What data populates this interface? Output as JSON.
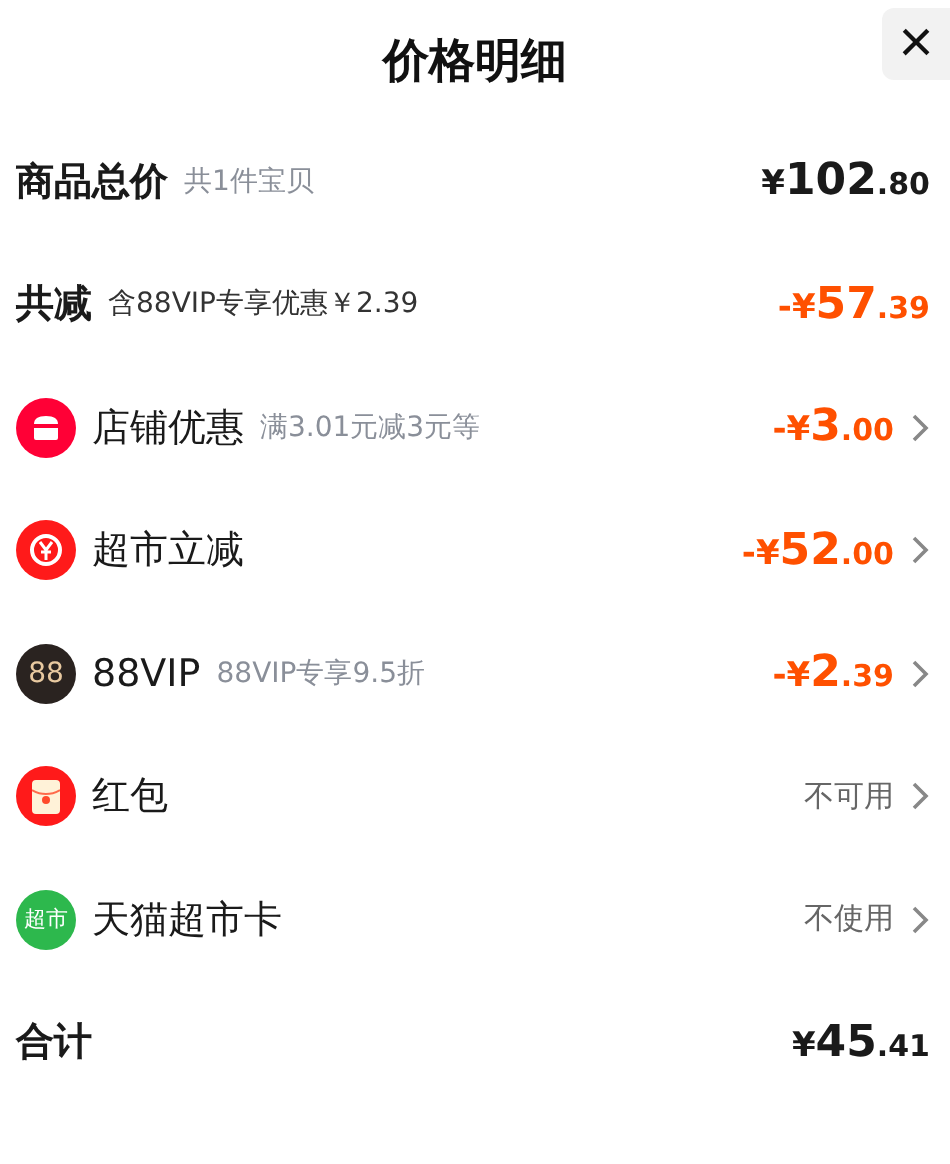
{
  "header": {
    "title": "价格明细",
    "close_label": "×"
  },
  "rows": [
    {
      "kind": "summary",
      "label": "商品总价",
      "note": "共1件宝贝",
      "amount": {
        "color": "#1a1a1a",
        "prefix": "¥",
        "integer": "102",
        "decimal": ".80"
      }
    },
    {
      "kind": "summary",
      "label": "共减",
      "note": "含88VIP专享优惠￥2.39",
      "amount": {
        "color": "#ff5000",
        "prefix": "-¥",
        "integer": "57",
        "decimal": ".39"
      }
    },
    {
      "kind": "item",
      "label": "店铺优惠",
      "note": "满3.01元减3元等",
      "amount": {
        "color": "#ff5000",
        "prefix": "-¥",
        "integer": "3",
        "decimal": ".00"
      }
    },
    {
      "kind": "item",
      "label": "超市立减",
      "amount": {
        "color": "#ff5000",
        "prefix": "-¥",
        "integer": "52",
        "decimal": ".00"
      }
    },
    {
      "kind": "item",
      "icon_text": "88",
      "label": "88VIP",
      "note": "88VIP专享9.5折",
      "amount": {
        "color": "#ff5000",
        "prefix": "-¥",
        "integer": "2",
        "decimal": ".39"
      }
    },
    {
      "kind": "item",
      "label": "红包",
      "status": "不可用"
    },
    {
      "kind": "item",
      "icon_text": "超市",
      "label": "天猫超市卡",
      "status": "不使用"
    },
    {
      "kind": "summary",
      "label": "合计",
      "amount": {
        "color": "#1a1a1a",
        "prefix": "¥",
        "integer": "45",
        "decimal": ".41"
      }
    }
  ]
}
